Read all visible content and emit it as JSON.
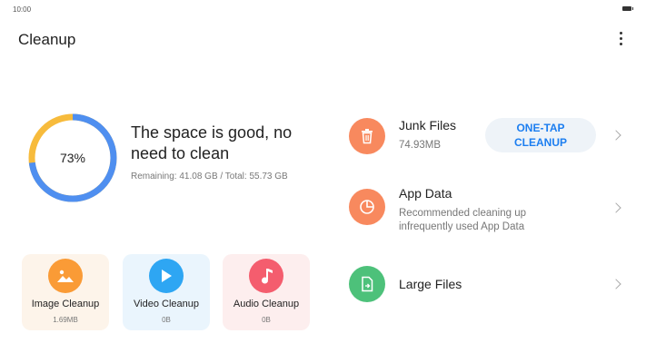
{
  "status_bar": {
    "time": "10:00"
  },
  "header": {
    "title": "Cleanup"
  },
  "storage": {
    "used_percent": 73,
    "percent_label": "73%",
    "headline": "The space is good, no need to clean",
    "info": "Remaining: 41.08 GB / Total: 55.73 GB"
  },
  "colors": {
    "donut_blue": "#4f8ff0",
    "donut_yellow": "#f7bb3c",
    "accent_blue": "#1c7ef0",
    "orange": "#f8895e",
    "green": "#4dc17a"
  },
  "tiles": [
    {
      "label": "Image Cleanup",
      "size": "1.69MB",
      "icon": "image-icon"
    },
    {
      "label": "Video Cleanup",
      "size": "0B",
      "icon": "play-icon"
    },
    {
      "label": "Audio Cleanup",
      "size": "0B",
      "icon": "music-note-icon"
    }
  ],
  "rows": {
    "junk": {
      "title": "Junk Files",
      "size": "74.93MB",
      "button": "ONE-TAP\nCLEANUP",
      "icon": "trash-icon"
    },
    "app_data": {
      "title": "App Data",
      "subtitle": "Recommended cleaning up infrequently used App Data",
      "icon": "pie-chart-icon"
    },
    "large_files": {
      "title": "Large Files",
      "icon": "file-icon"
    }
  }
}
